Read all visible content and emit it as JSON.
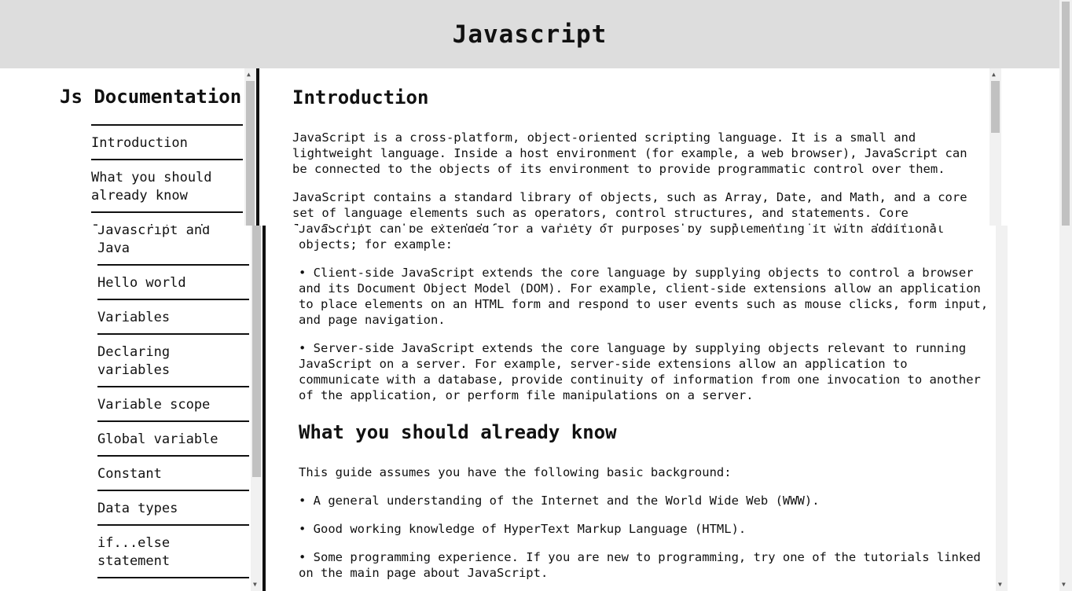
{
  "header": {
    "title": "Javascript"
  },
  "nav": {
    "title": "Js Documentation",
    "items": [
      "Introduction",
      "What you should already know",
      "Javascript and Java",
      "Hello world",
      "Variables",
      "Declaring variables",
      "Variable scope",
      "Global variable",
      "Constant",
      "Data types",
      "if...else statement"
    ]
  },
  "main": {
    "introduction": {
      "title": "Introduction",
      "p1": "JavaScript is a cross-platform, object-oriented scripting language. It is a small and lightweight language. Inside a host environment (for example, a web browser), JavaScript can be connected to the objects of its environment to provide programmatic control over them.",
      "p2": "JavaScript contains a standard library of objects, such as Array, Date, and Math, and a core set of language elements such as operators, control structures, and statements. Core JavaScript can be extended for a variety of purposes by supplementing it with additional objects; for example:",
      "p3": "• Client-side JavaScript extends the core language by supplying objects to control a browser and its Document Object Model (DOM). For example, client-side extensions allow an application to place elements on an HTML form and respond to user events such as mouse clicks, form input, and page navigation.",
      "p4": "• Server-side JavaScript extends the core language by supplying objects relevant to running JavaScript on a server. For example, server-side extensions allow an application to communicate with a database, provide continuity of information from one invocation to another of the application, or perform file manipulations on a server."
    },
    "what_you_should_know": {
      "title": "What you should already know",
      "p1": "This guide assumes you have the following basic background:",
      "p2": "• A general understanding of the Internet and the World Wide Web (WWW).",
      "p3": "• Good working knowledge of HyperText Markup Language (HTML).",
      "p4": "• Some programming experience. If you are new to programming, try one of the tutorials linked on the main page about JavaScript."
    }
  }
}
